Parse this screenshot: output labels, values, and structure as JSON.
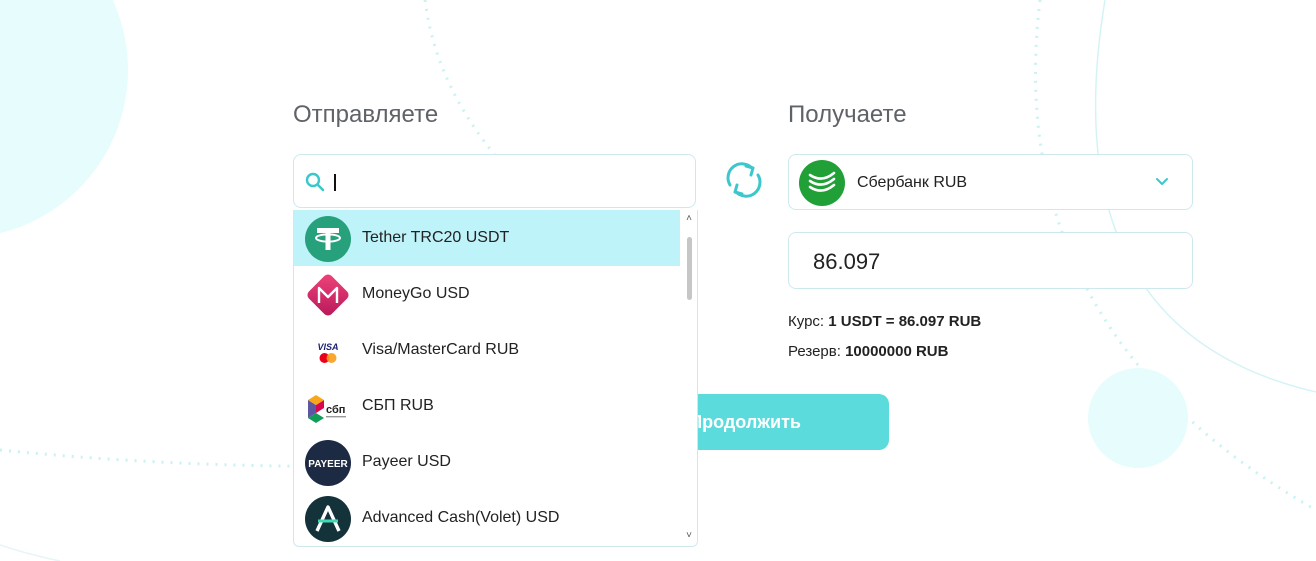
{
  "send": {
    "heading": "Отправляете",
    "search": {
      "value": "",
      "placeholder": ""
    },
    "options": [
      {
        "label": "Tether TRC20 USDT",
        "icon": "tether-icon",
        "active": true
      },
      {
        "label": "MoneyGo USD",
        "icon": "moneygo-icon",
        "active": false
      },
      {
        "label": "Visa/MasterCard RUB",
        "icon": "visa-mastercard-icon",
        "active": false
      },
      {
        "label": "СБП RUB",
        "icon": "sbp-icon",
        "icon_text": "сбп",
        "active": false
      },
      {
        "label": "Payeer USD",
        "icon": "payeer-icon",
        "icon_text": "PAYEER",
        "active": false
      },
      {
        "label": "Advanced Cash(Volet) USD",
        "icon": "advcash-icon",
        "active": false
      }
    ]
  },
  "receive": {
    "heading": "Получаете",
    "selected": {
      "label": "Сбербанк RUB",
      "icon": "sberbank-icon"
    },
    "amount": "86.097",
    "rate": {
      "label": "Курс:",
      "value": "1 USDT = 86.097 RUB"
    },
    "reserve": {
      "label": "Резерв:",
      "value": "10000000 RUB"
    }
  },
  "actions": {
    "continue_label": "Продолжить"
  },
  "colors": {
    "accent": "#5cdbdd",
    "active_option": "#bff3fa",
    "border": "#cde9ee",
    "swap_icon": "#3cc7cc",
    "tether": "#26a17b",
    "sberbank": "#21a038"
  }
}
